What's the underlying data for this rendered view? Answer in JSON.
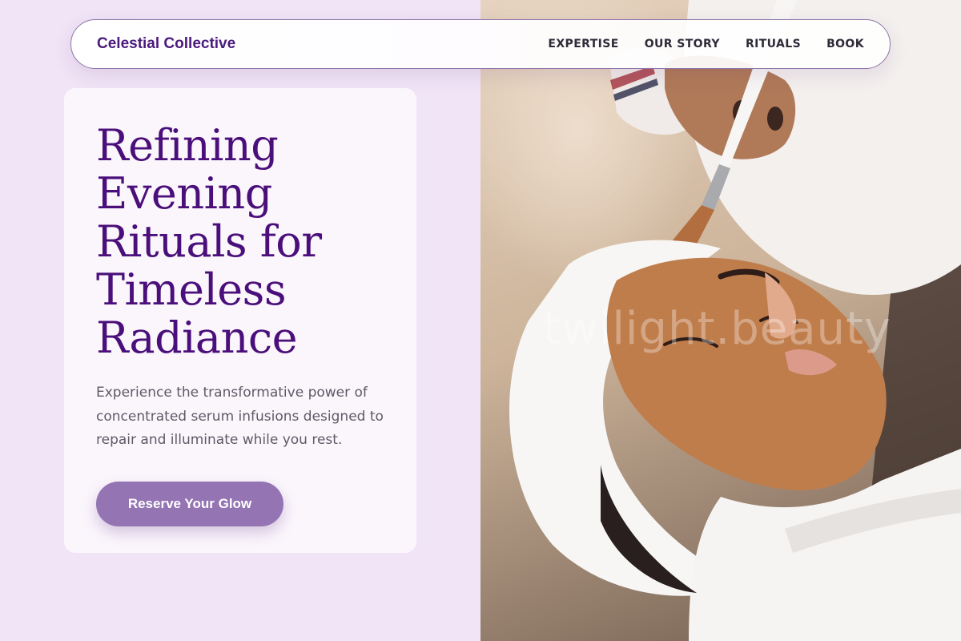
{
  "nav": {
    "brand": "Celestial Collective",
    "links": [
      "EXPERTISE",
      "OUR STORY",
      "RITUALS",
      "BOOK"
    ]
  },
  "hero": {
    "headline": "Refining Evening Rituals for Timeless Radiance",
    "subtext": "Experience the transformative power of concentrated serum infusions designed to repair and illuminate while you rest.",
    "cta_label": "Reserve Your Glow"
  },
  "photo": {
    "description": "Woman receiving a clay facial mask applied with a brush",
    "watermark": "twilight.beauty"
  },
  "colors": {
    "page_background": "#f1e4f6",
    "brand_text": "#4b1a7d",
    "headline": "#4a0f7a",
    "cta_background": "#9474b3",
    "nav_border": "#8d76a8"
  }
}
